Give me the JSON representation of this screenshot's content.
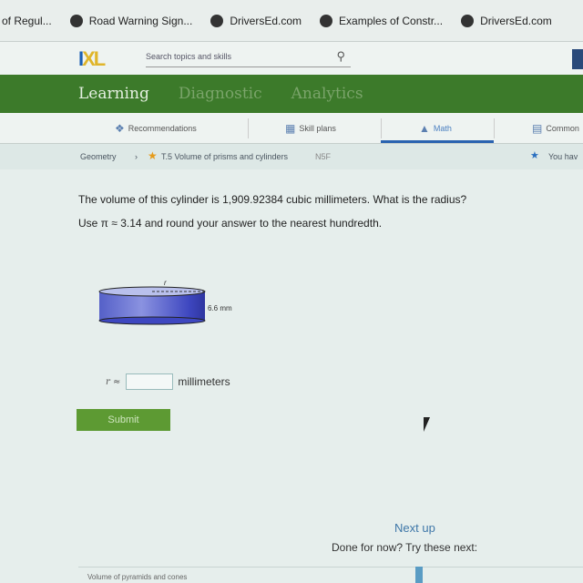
{
  "bookmarks": [
    "of Regul...",
    "Road Warning Sign...",
    "DriversEd.com",
    "Examples of Constr...",
    "DriversEd.com"
  ],
  "header": {
    "logo": "IXL",
    "search_placeholder": "Search topics and skills"
  },
  "main_nav": [
    "Learning",
    "Diagnostic",
    "Analytics"
  ],
  "sub_nav": [
    {
      "label": "Recommendations",
      "icon": "recommendations-icon"
    },
    {
      "label": "Skill plans",
      "icon": "skill-plans-icon"
    },
    {
      "label": "Math",
      "icon": "math-icon",
      "active": true
    },
    {
      "label": "Common",
      "icon": "common-core-icon"
    }
  ],
  "breadcrumb": {
    "subject": "Geometry",
    "skill": "T.5 Volume of prisms and cylinders",
    "code": "N5F",
    "award_text": "You hav"
  },
  "question": {
    "line1": "The volume of this cylinder is 1,909.92384 cubic millimeters. What is the radius?",
    "line2": "Use π ≈ 3.14 and round your answer to the nearest hundredth.",
    "radius_label": "r",
    "height_label": "6.6 mm"
  },
  "answer": {
    "prefix": "r ≈",
    "value": "",
    "unit": "millimeters"
  },
  "submit_label": "Submit",
  "next": {
    "title": "Next up",
    "subtitle": "Done for now? Try these next:",
    "item": "Volume of pyramids and cones"
  },
  "colors": {
    "green": "#3c7a2a",
    "submit": "#5d9a33",
    "link": "#3f77a8"
  }
}
